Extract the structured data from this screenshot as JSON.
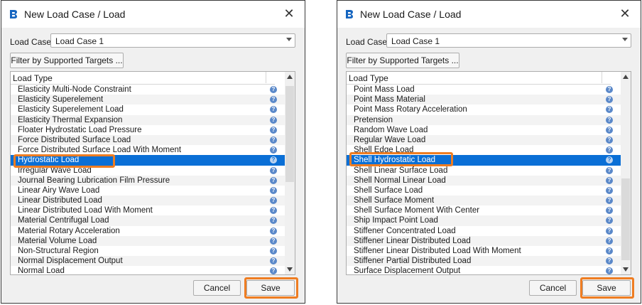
{
  "dialogs": [
    {
      "title": "New Load Case / Load",
      "load_case_label": "Load Case",
      "load_case_value": "Load Case 1",
      "filter_button": "Filter by Supported Targets ...",
      "list_header": "Load Type",
      "selected_index": 7,
      "items": [
        "Elasticity Multi-Node Constraint",
        "Elasticity Superelement",
        "Elasticity Superelement Load",
        "Elasticity Thermal Expansion",
        "Floater Hydrostatic Load Pressure",
        "Force Distributed Surface Load",
        "Force Distributed Surface Load With Moment",
        "Hydrostatic Load",
        "Irregular Wave Load",
        "Journal Bearing Lubrication Film Pressure",
        "Linear Airy Wave Load",
        "Linear Distributed Load",
        "Linear Distributed Load With Moment",
        "Material Centrifugal Load",
        "Material Rotary Acceleration",
        "Material Volume Load",
        "Non-Structural Region",
        "Normal Displacement Output",
        "Normal Load"
      ],
      "cancel_label": "Cancel",
      "save_label": "Save"
    },
    {
      "title": "New Load Case / Load",
      "load_case_label": "Load Case",
      "load_case_value": "Load Case 1",
      "filter_button": "Filter by Supported Targets ...",
      "list_header": "Load Type",
      "selected_index": 7,
      "items": [
        "Point Mass Load",
        "Point Mass Material",
        "Point Mass Rotary Acceleration",
        "Pretension",
        "Random Wave Load",
        "Regular Wave Load",
        "Shell Edge Load",
        "Shell Hydrostatic Load",
        "Shell Linear Surface Load",
        "Shell Normal Linear Load",
        "Shell Surface Load",
        "Shell Surface Moment",
        "Shell Surface Moment With Center",
        "Ship Impact Point Load",
        "Stiffener Concentrated Load",
        "Stiffener Linear Distributed Load",
        "Stiffener Linear Distributed Load With Moment",
        "Stiffener Partial Distributed Load",
        "Surface Displacement Output"
      ],
      "cancel_label": "Cancel",
      "save_label": "Save"
    }
  ],
  "icons": {
    "app": "app-logo-icon",
    "close": "close-icon",
    "info": "info-icon",
    "dropdown": "chevron-down-icon",
    "scroll_up": "scroll-up-arrow-icon",
    "scroll_down": "scroll-down-arrow-icon"
  },
  "colors": {
    "selection": "#0a6fd6",
    "highlight": "#ef7d22",
    "info_icon": "#5a88c9"
  }
}
